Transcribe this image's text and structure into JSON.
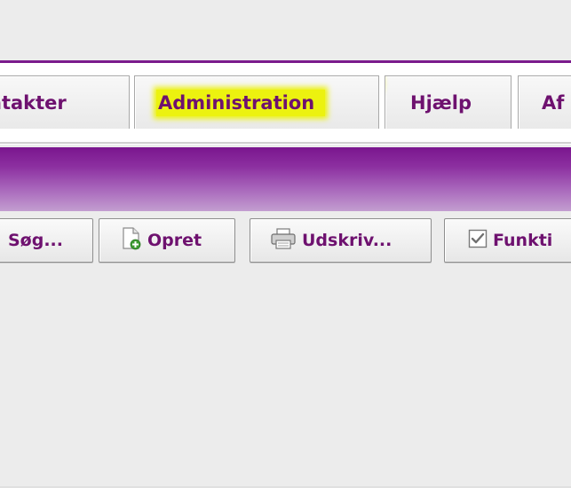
{
  "tabs": [
    {
      "label": "ntakter"
    },
    {
      "label": "Administration"
    },
    {
      "label": "Hjælp"
    },
    {
      "label": "Af"
    }
  ],
  "toolbar": {
    "search_label": "Søg...",
    "create_label": "Opret",
    "print_label": "Udskriv...",
    "functions_label": "Funkti"
  },
  "colors": {
    "accent": "#7b1b8c",
    "label": "#6e116f",
    "highlight": "#ecf20f"
  }
}
